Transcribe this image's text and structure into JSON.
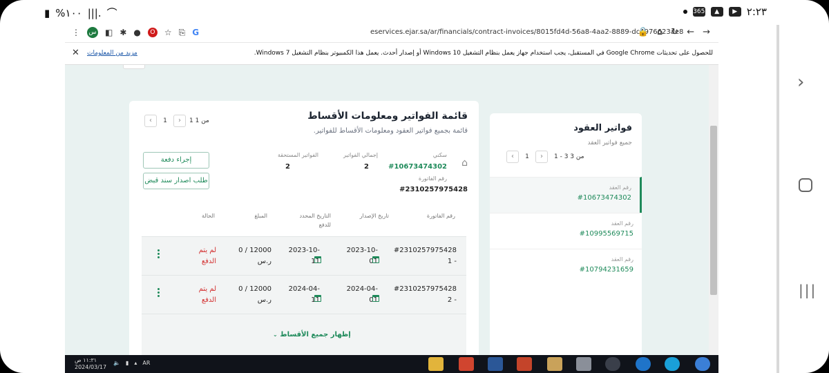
{
  "status_bar": {
    "left": "%١٠٠",
    "time": "٢:٢٣"
  },
  "browser": {
    "url": "eservices.ejar.sa/ar/financials/contract-invoices/8015fd4d-56a8-4aa2-8889-dc4976623ae8",
    "ext_badge": "س",
    "info_message": "للحصول على تحديثات Google Chrome في المستقبل، يجب استخدام جهاز يعمل بنظام التشغيل Windows 10 أو إصدار أحدث. يعمل هذا الكمبيوتر بنظام التشغيل Windows 7.",
    "info_link": "مزيد من المعلومات",
    "close": "✕"
  },
  "invoices": {
    "title": "قائمة الفواتير ومعلومات الأقساط",
    "subtitle": "قائمة بجميع فواتير العقود ومعلومات الأقساط للفواتير.",
    "pager": {
      "text": "1 من 1",
      "page": "1"
    },
    "property_label": "سكني",
    "property_value": "#10673474302",
    "total_label": "إجمالي الفواتير",
    "total_value": "2",
    "due_label": "الفواتير المستحقة",
    "due_value": "2",
    "invoice_no_label": "رقم الفاتورة",
    "invoice_no_value": "#2310257975428",
    "pay_button": "إجراء دفعة",
    "receipt_button": "طلب اصدار سند قبض",
    "columns": [
      "رقم الفاتورة",
      "تاريخ الإصدار",
      "التاريخ المحدد للدفع",
      "المبلغ",
      "الحالة"
    ],
    "rows": [
      {
        "invoice": "#2310257975428 - 1",
        "issue": "2023-10-01",
        "due": "2023-10-11",
        "amount": "12000 / 0 ر.س",
        "status": "لم يتم الدفع"
      },
      {
        "invoice": "#2310257975428 - 2",
        "issue": "2024-04-01",
        "due": "2024-04-11",
        "amount": "12000 / 0 ر.س",
        "status": "لم يتم الدفع"
      }
    ],
    "show_all": "إظهار جميع الأقساط"
  },
  "contracts": {
    "title": "فواتير العقود",
    "subtitle": "جميع فواتير العقد",
    "pager": {
      "text": "1 - 3 من 3",
      "page": "1"
    },
    "items": [
      {
        "label": "رقم العقد",
        "value": "#10673474302"
      },
      {
        "label": "رقم العقد",
        "value": "#10995569715"
      },
      {
        "label": "رقم العقد",
        "value": "#10794231659"
      }
    ]
  },
  "taskbar": {
    "time": "١١:٣١ ص",
    "date": "2024/03/17",
    "lang": "AR"
  },
  "colors": {
    "accent": "#1e8a5a",
    "status_unpaid": "#d32f2f",
    "page_bg": "#e9f2f1"
  }
}
